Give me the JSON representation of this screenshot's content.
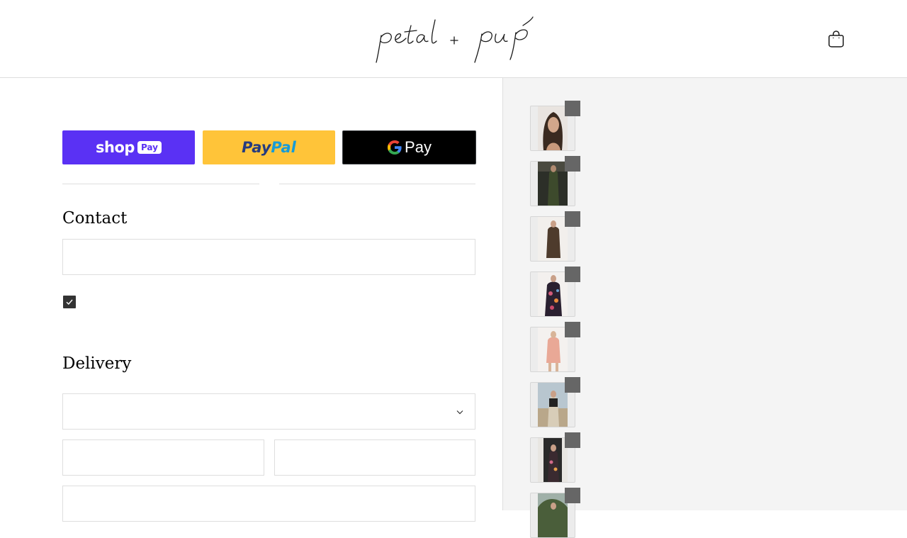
{
  "header": {
    "logo_text": "petal + pup",
    "cart_icon": "shopping-bag-icon"
  },
  "express_checkout": {
    "shop_pay": {
      "label_main": "shop",
      "label_badge": "Pay",
      "color": "#5a31f4"
    },
    "paypal": {
      "label_pay": "Pay",
      "label_pal": "Pal",
      "color": "#ffc439"
    },
    "google_pay": {
      "label": "Pay",
      "color": "#000000"
    }
  },
  "contact": {
    "title": "Contact",
    "email_value": "",
    "marketing_opt_in_checked": true
  },
  "delivery": {
    "title": "Delivery",
    "country_value": "",
    "first_name_value": "",
    "last_name_value": "",
    "address_value": ""
  },
  "order_summary": {
    "items": [
      {
        "quantity": "",
        "image_desc": "woman-portrait"
      },
      {
        "quantity": "",
        "image_desc": "dark-dress"
      },
      {
        "quantity": "",
        "image_desc": "brown-dress"
      },
      {
        "quantity": "",
        "image_desc": "floral-dress"
      },
      {
        "quantity": "",
        "image_desc": "pink-set"
      },
      {
        "quantity": "",
        "image_desc": "beach-outfit"
      },
      {
        "quantity": "",
        "image_desc": "floral-outdoor"
      },
      {
        "quantity": "",
        "image_desc": "outdoor-dress"
      }
    ]
  },
  "colors": {
    "border": "#dedede",
    "sidebar_bg": "#f4f4f4",
    "badge_bg": "#666666"
  }
}
